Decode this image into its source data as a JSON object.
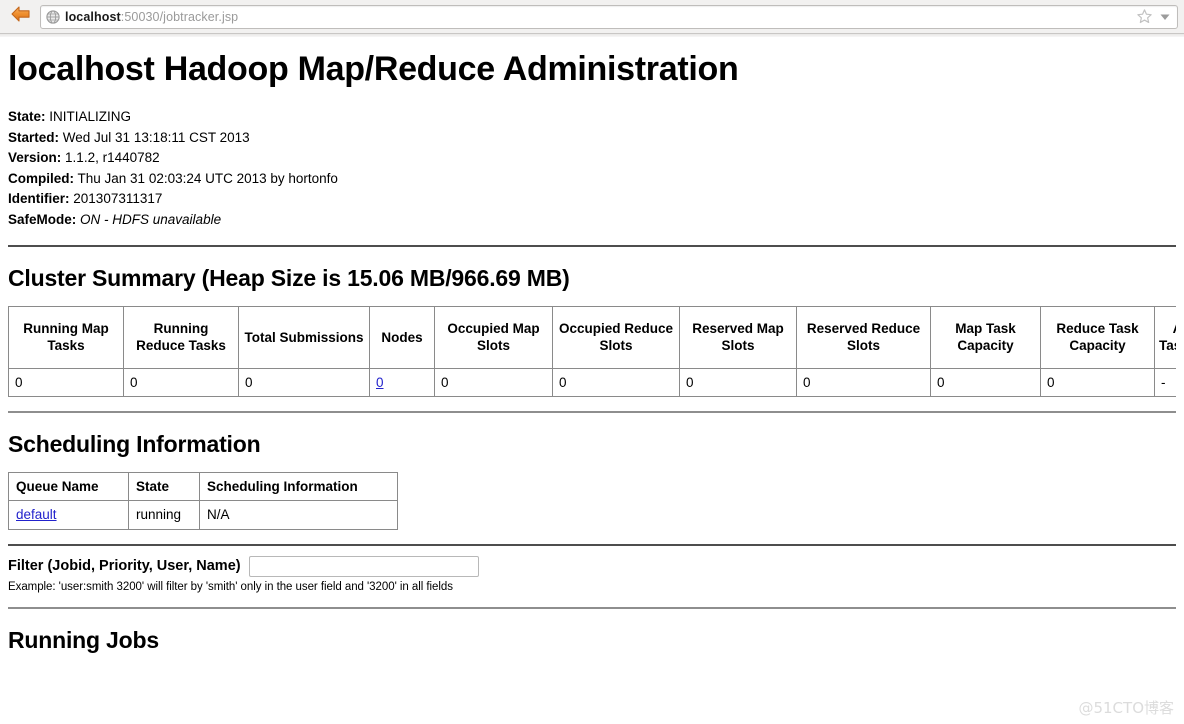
{
  "browser": {
    "back_icon": "back-arrow-icon",
    "site_icon": "globe-icon",
    "url_host": "localhost",
    "url_path": ":50030/jobtracker.jsp",
    "bookmark_icon": "star-icon",
    "dropdown_icon": "chevron-down-icon"
  },
  "page": {
    "title": "localhost Hadoop Map/Reduce Administration",
    "watermark": "@51CTO博客"
  },
  "status": {
    "items": [
      {
        "label": "State:",
        "value": "INITIALIZING",
        "italic": false
      },
      {
        "label": "Started:",
        "value": "Wed Jul 31 13:18:11 CST 2013",
        "italic": false
      },
      {
        "label": "Version:",
        "value": "1.1.2, r1440782",
        "italic": false
      },
      {
        "label": "Compiled:",
        "value": "Thu Jan 31 02:03:24 UTC 2013 by hortonfo",
        "italic": false
      },
      {
        "label": "Identifier:",
        "value": "201307311317",
        "italic": false
      },
      {
        "label": "SafeMode:",
        "value": "ON - HDFS unavailable",
        "italic": true
      }
    ]
  },
  "cluster_summary": {
    "heading": "Cluster Summary (Heap Size is 15.06 MB/966.69 MB)",
    "columns": [
      "Running Map Tasks",
      "Running Reduce Tasks",
      "Total Submissions",
      "Nodes",
      "Occupied Map Slots",
      "Occupied Reduce Slots",
      "Reserved Map Slots",
      "Reserved Reduce Slots",
      "Map Task Capacity",
      "Reduce Task Capacity",
      "Avg. Tasks/Node"
    ],
    "row": [
      {
        "value": "0",
        "link": false
      },
      {
        "value": "0",
        "link": false
      },
      {
        "value": "0",
        "link": false
      },
      {
        "value": "0",
        "link": true
      },
      {
        "value": "0",
        "link": false
      },
      {
        "value": "0",
        "link": false
      },
      {
        "value": "0",
        "link": false
      },
      {
        "value": "0",
        "link": false
      },
      {
        "value": "0",
        "link": false
      },
      {
        "value": "0",
        "link": false
      },
      {
        "value": "-",
        "link": false
      }
    ]
  },
  "scheduling": {
    "heading": "Scheduling Information",
    "columns": [
      "Queue Name",
      "State",
      "Scheduling Information"
    ],
    "rows": [
      {
        "queue_name": "default",
        "state": "running",
        "info": "N/A"
      }
    ]
  },
  "filter": {
    "label": "Filter (Jobid, Priority, User, Name)",
    "value": "",
    "placeholder": "",
    "example": "Example: 'user:smith 3200' will filter by 'smith' only in the user field and '3200' in all fields"
  },
  "running_jobs": {
    "heading": "Running Jobs"
  },
  "colors": {
    "link": "#2222cc",
    "rule": "#4d4d4d",
    "border": "#8a8a8a"
  }
}
